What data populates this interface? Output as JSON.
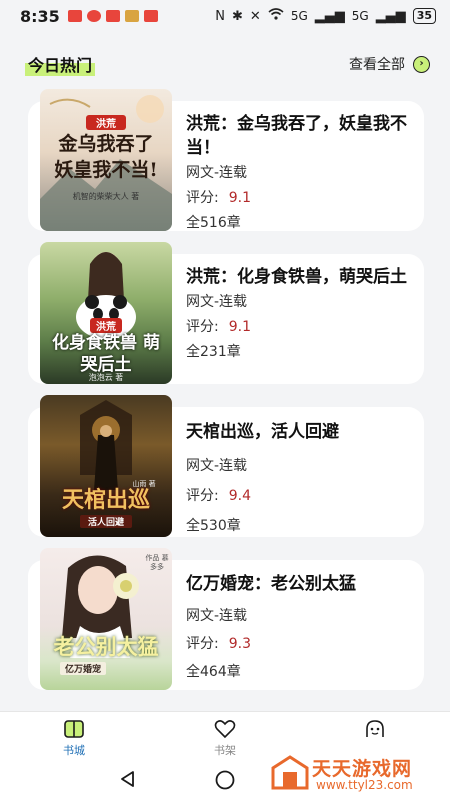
{
  "status_bar": {
    "time": "8:35",
    "notification_colors": [
      "#e8453c",
      "#e8453c",
      "#d9a441",
      "#e8453c",
      "#e8453c"
    ],
    "signal_1": "5G",
    "signal_2": "5G",
    "battery": "35"
  },
  "section": {
    "title": "今日热门",
    "see_all_label": "查看全部",
    "accent_color": "#c9f07a"
  },
  "books": [
    {
      "title": "洪荒：金乌我吞了，妖皇我不当！",
      "category": "网文-连载",
      "score_label": "评分:",
      "score": "9.1",
      "chapters": "全516章",
      "cover_text_main": "金乌我吞了 妖皇我不当!",
      "cover_tag": "洪荒",
      "cover_author": "机智的柴柴大人 著"
    },
    {
      "title": "洪荒：化身食铁兽，萌哭后土",
      "category": "网文-连载",
      "score_label": "评分:",
      "score": "9.1",
      "chapters": "全231章",
      "cover_text_main": "化身食铁兽 萌哭后土",
      "cover_tag": "洪荒",
      "cover_author": "泡泡云 著"
    },
    {
      "title": "天棺出巡，活人回避",
      "category": "网文-连载",
      "score_label": "评分:",
      "score": "9.4",
      "chapters": "全530章",
      "cover_text_main": "天棺出巡",
      "cover_tag": "活人回避",
      "cover_author": "山雨 著"
    },
    {
      "title": "亿万婚宠：老公别太猛",
      "category": "网文-连载",
      "score_label": "评分:",
      "score": "9.3",
      "chapters": "全464章",
      "cover_text_main": "老公别太猛",
      "cover_tag": "亿万婚宠",
      "cover_author": "作品 慕多多"
    }
  ],
  "tabs": [
    {
      "label": "书城",
      "icon": "book-city-icon",
      "active": true
    },
    {
      "label": "书架",
      "icon": "heart-icon",
      "active": false
    },
    {
      "label": "",
      "icon": "profile-icon",
      "active": false
    }
  ],
  "nav": {
    "back": "back-triangle",
    "home": "home-circle"
  },
  "watermark": {
    "title": "天天游戏网",
    "url": "www.ttyl23.com",
    "color": "#e8692c"
  }
}
